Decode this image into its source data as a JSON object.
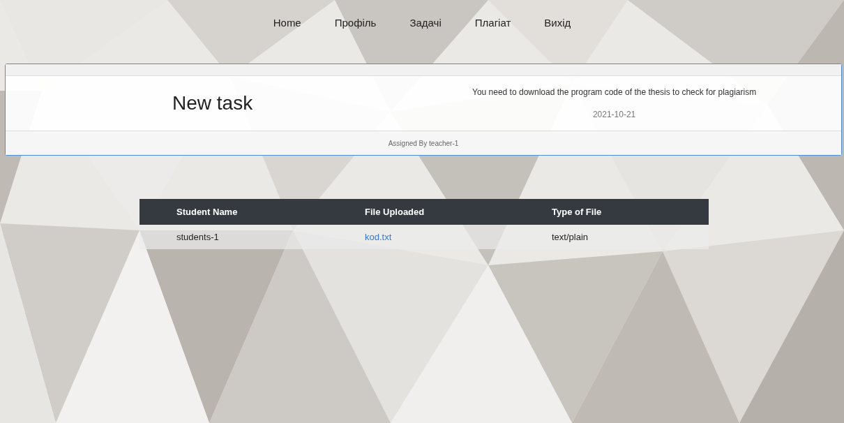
{
  "nav": {
    "items": [
      "Home",
      "Профіль",
      "Задачі",
      "Плагіат",
      "Вихід"
    ]
  },
  "task": {
    "title": "New task",
    "description": "You need to download the program code of the thesis to check for plagiarism",
    "date": "2021-10-21",
    "assigned": "Assigned By teacher-1"
  },
  "table": {
    "columns": [
      "Student Name",
      "File Uploaded",
      "Type of File"
    ],
    "rows": [
      {
        "student": "students-1",
        "file": "kod.txt",
        "type": "text/plain"
      }
    ]
  }
}
